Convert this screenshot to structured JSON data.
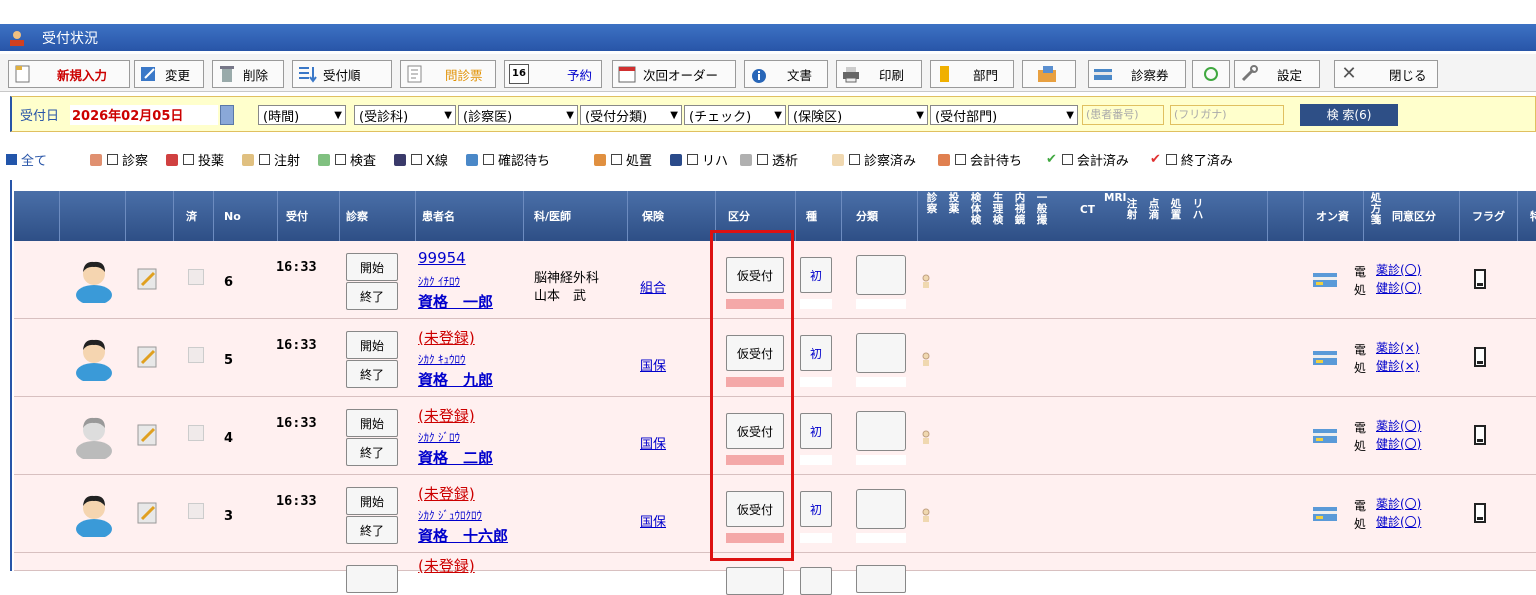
{
  "window": {
    "title": "受付状況"
  },
  "toolbar": [
    {
      "label": "新規入力",
      "color": "#cc0000"
    },
    {
      "label": "変更"
    },
    {
      "label": "削除"
    },
    {
      "label": "受付順"
    },
    {
      "label": "問診票",
      "color": "#e09000"
    },
    {
      "label": "予約",
      "badge": "16",
      "color": "#0000cc"
    },
    {
      "label": "次回オーダー"
    },
    {
      "label": "文書"
    },
    {
      "label": "印刷"
    },
    {
      "label": "部門"
    },
    {
      "label": "診察券"
    },
    {
      "label": "設定"
    },
    {
      "label": "閉じる"
    }
  ],
  "search": {
    "date_label": "受付日",
    "date_value": "2026年02月05日",
    "selects": [
      "(時間)",
      "(受診科)",
      "(診察医)",
      "(受付分類)",
      "(チェック)",
      "(保険区)",
      "(受付部門)"
    ],
    "patient_no_placeholder": "(患者番号)",
    "kana_placeholder": "(フリガナ)",
    "search_button": "検 索(6)"
  },
  "filters": [
    {
      "label": "全て",
      "checked": true
    },
    {
      "label": "診察"
    },
    {
      "label": "投薬"
    },
    {
      "label": "注射"
    },
    {
      "label": "検査"
    },
    {
      "label": "X線"
    },
    {
      "label": "確認待ち"
    },
    {
      "label": "処置"
    },
    {
      "label": "リハ"
    },
    {
      "label": "透析"
    },
    {
      "label": "診察済み"
    },
    {
      "label": "会計待ち"
    },
    {
      "label": "会計済み"
    },
    {
      "label": "終了済み"
    }
  ],
  "table": {
    "headers": {
      "done": "済",
      "no": "No",
      "reception": "受付",
      "exam": "診察",
      "patient": "患者名",
      "dept": "科/医師",
      "insurance": "保険",
      "kubun": "区分",
      "kind": "種",
      "bunrui": "分類",
      "online": "オン資",
      "consent": "同意区分",
      "flag": "フラグ",
      "trailing": "特"
    },
    "vertical_headers": [
      "診察",
      "投薬",
      "検体検",
      "生理検",
      "内視鏡",
      "一般撮",
      "CT",
      "MRI",
      "注射",
      "点滴",
      "処置",
      "リハ"
    ],
    "shohousen_header": "処方箋",
    "rows": [
      {
        "no": "6",
        "time": "16:33",
        "start": "開始",
        "end": "終了",
        "id": "99954",
        "kana": "ｼｶｸ ｲﾁﾛｳ",
        "name": "資格　一郎",
        "dept": "脳神経外科",
        "doctor": "山本　武",
        "insurance": "組合",
        "kubun": "仮受付",
        "kind": "初",
        "den": "電",
        "sho": "処",
        "yakushin": "薬診(〇)",
        "kenshin": "健診(〇)"
      },
      {
        "no": "5",
        "time": "16:33",
        "start": "開始",
        "end": "終了",
        "id": "(未登録)",
        "kana": "ｼｶｸ ｷｭｳﾛｳ",
        "name": "資格　九郎",
        "dept": "",
        "doctor": "",
        "insurance": "国保",
        "kubun": "仮受付",
        "kind": "初",
        "den": "電",
        "sho": "処",
        "yakushin": "薬診(×)",
        "kenshin": "健診(×)"
      },
      {
        "no": "4",
        "time": "16:33",
        "start": "開始",
        "end": "終了",
        "id": "(未登録)",
        "kana": "ｼｶｸ ｼﾞﾛｳ",
        "name": "資格　二郎",
        "dept": "",
        "doctor": "",
        "insurance": "国保",
        "kubun": "仮受付",
        "kind": "初",
        "den": "電",
        "sho": "処",
        "yakushin": "薬診(〇)",
        "kenshin": "健診(〇)"
      },
      {
        "no": "3",
        "time": "16:33",
        "start": "開始",
        "end": "終了",
        "id": "(未登録)",
        "kana": "ｼｶｸ ｼﾞｭｳﾛｸﾛｳ",
        "name": "資格　十六郎",
        "dept": "",
        "doctor": "",
        "insurance": "国保",
        "kubun": "仮受付",
        "kind": "初",
        "den": "電",
        "sho": "処",
        "yakushin": "薬診(〇)",
        "kenshin": "健診(〇)"
      }
    ],
    "partial_row_id": "(未登録)"
  }
}
